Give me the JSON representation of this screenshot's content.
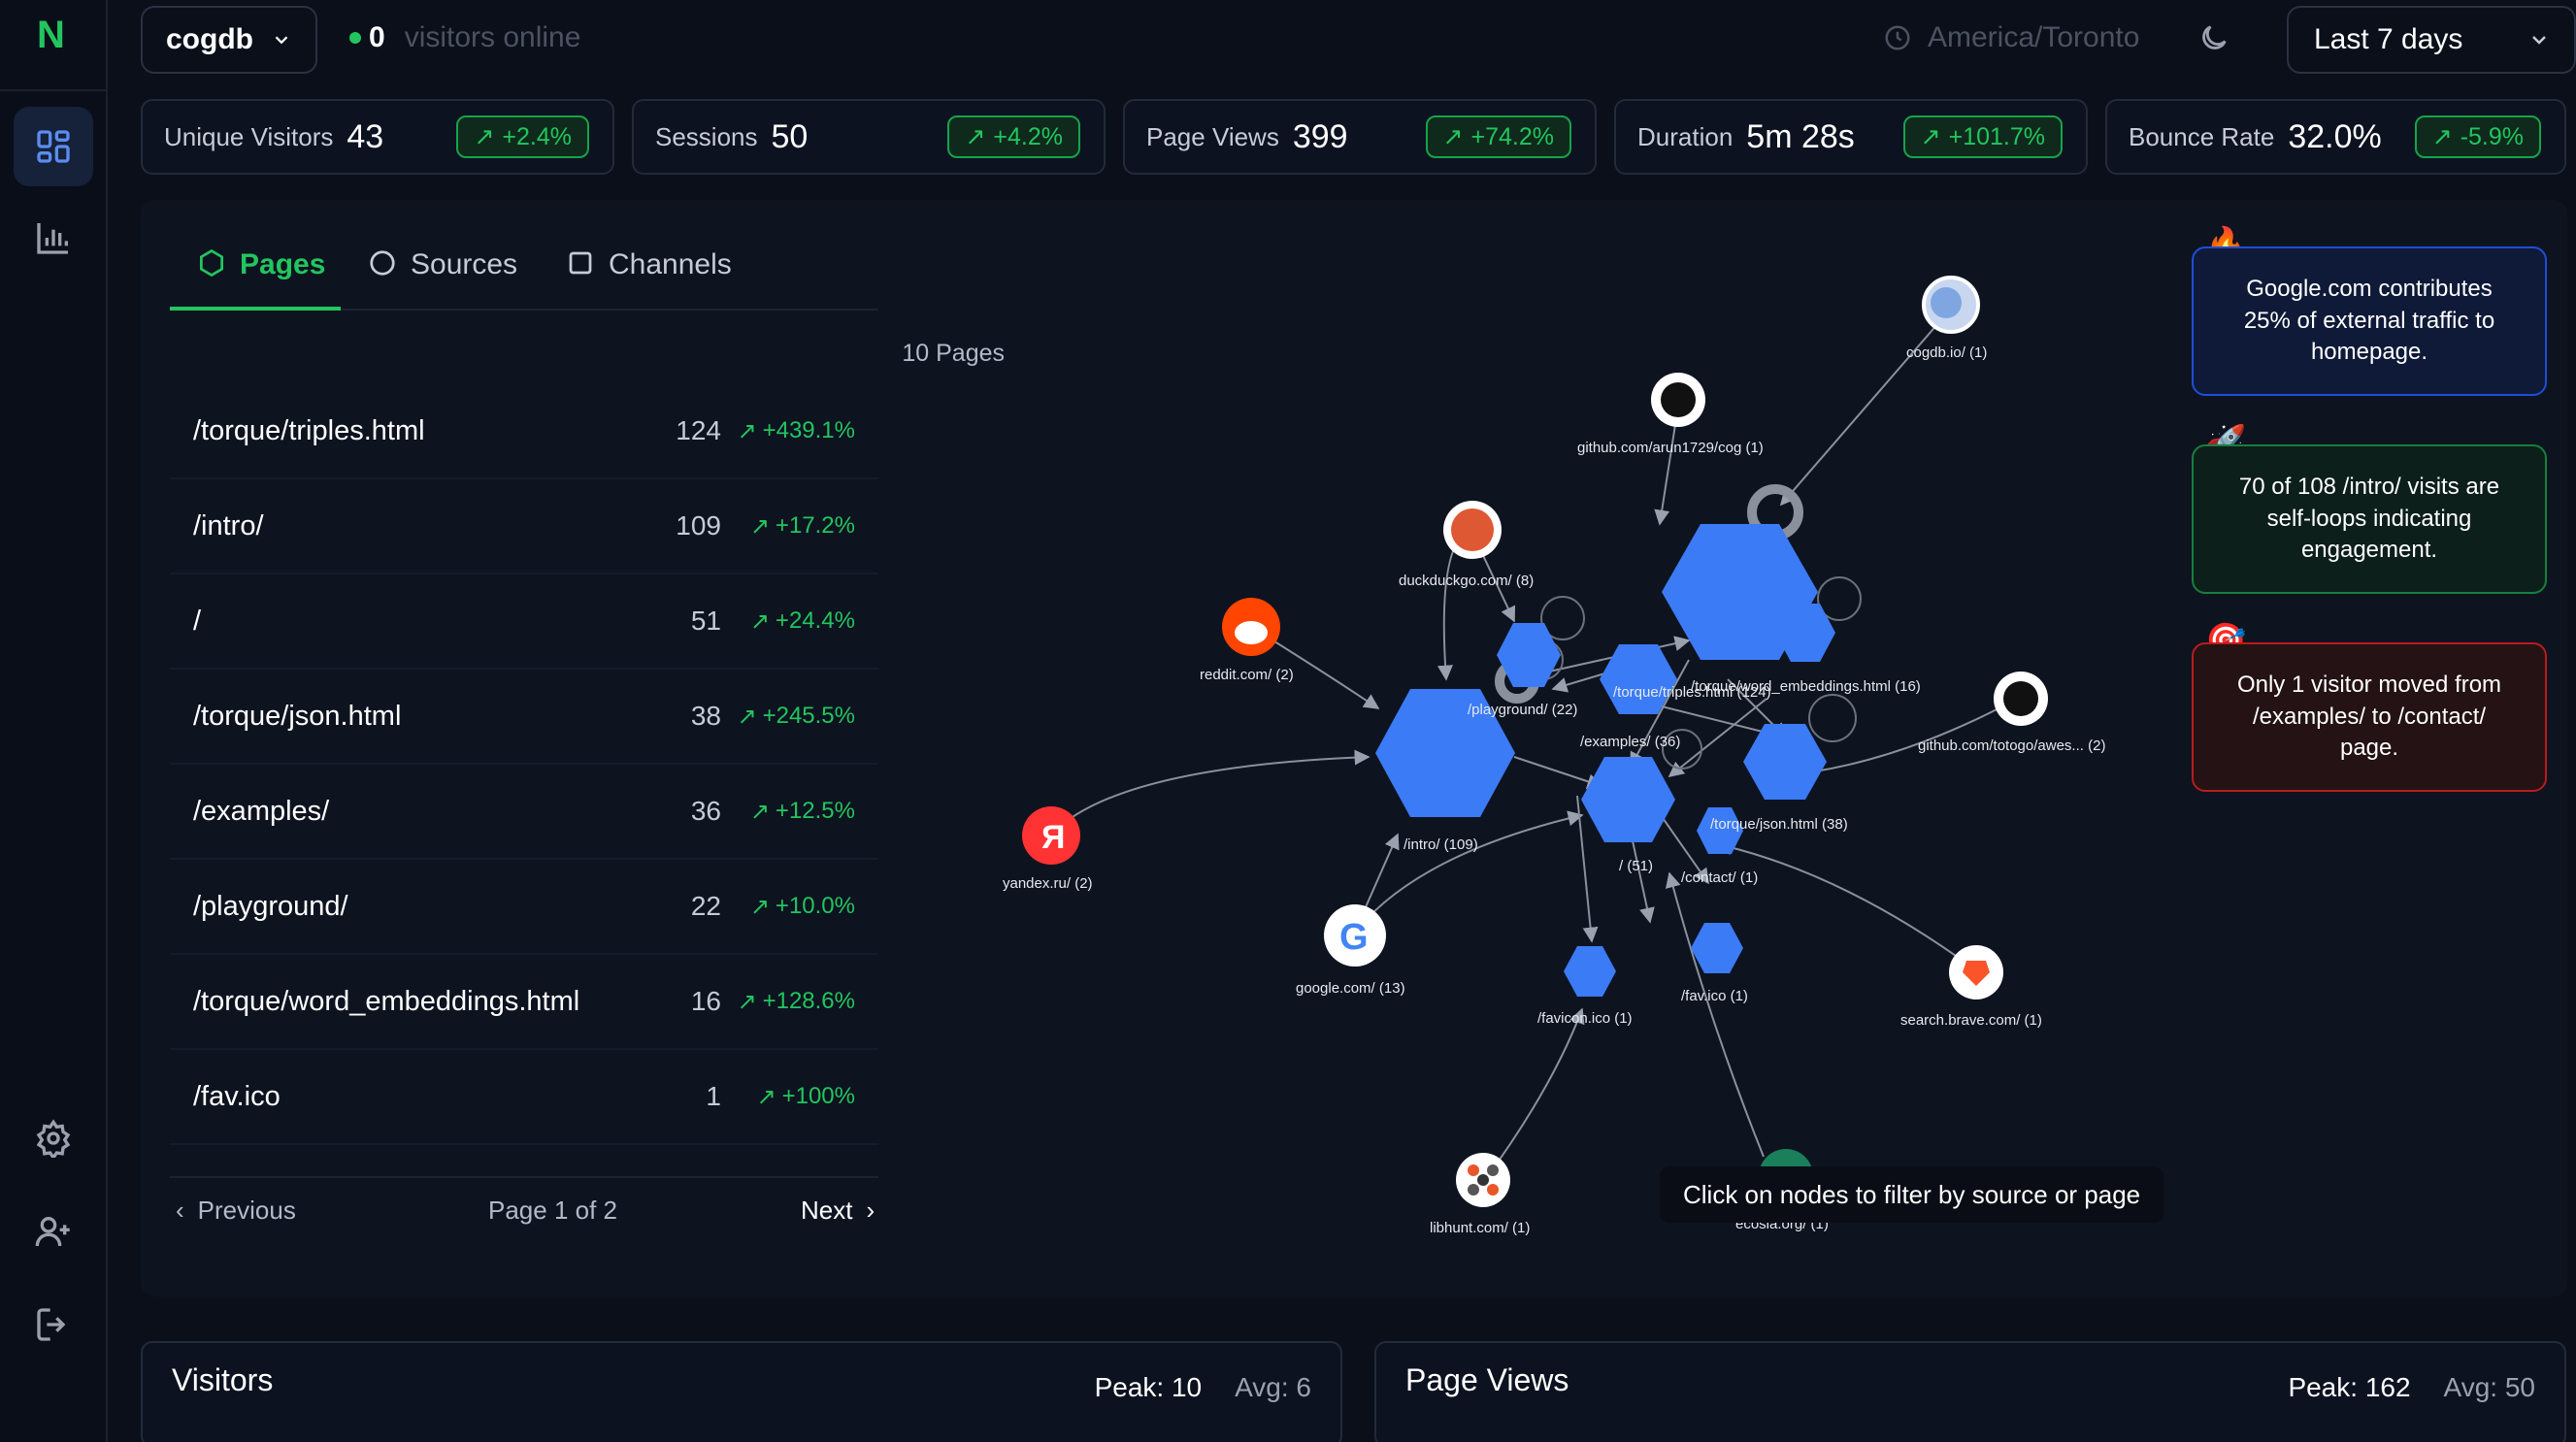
{
  "app": {
    "logo": "N",
    "site": "cogdb",
    "online_count": "0",
    "online_label": "visitors online",
    "timezone": "America/Toronto",
    "date_range": "Last 7 days"
  },
  "sidebar": {
    "items": [
      {
        "name": "dashboard",
        "icon": "dashboard-grid-icon",
        "active": true
      },
      {
        "name": "analytics",
        "icon": "bar-chart-icon"
      },
      {
        "name": "settings",
        "icon": "gear-icon"
      },
      {
        "name": "add-user",
        "icon": "add-user-icon"
      },
      {
        "name": "logout",
        "icon": "logout-icon"
      }
    ]
  },
  "stats": [
    {
      "label": "Unique Visitors",
      "value": "43",
      "change": "+2.4%"
    },
    {
      "label": "Sessions",
      "value": "50",
      "change": "+4.2%"
    },
    {
      "label": "Page Views",
      "value": "399",
      "change": "+74.2%"
    },
    {
      "label": "Duration",
      "value": "5m 28s",
      "change": "+101.7%"
    },
    {
      "label": "Bounce Rate",
      "value": "32.0%",
      "change": "-5.9%"
    }
  ],
  "tabs": [
    {
      "label": "Pages",
      "active": true,
      "icon": "hexagon-icon"
    },
    {
      "label": "Sources",
      "icon": "circle-icon"
    },
    {
      "label": "Channels",
      "icon": "square-icon"
    }
  ],
  "pages": {
    "count_label": "10 Pages",
    "rows": [
      {
        "path": "/torque/triples.html",
        "count": "124",
        "change": "+439.1%"
      },
      {
        "path": "/intro/",
        "count": "109",
        "change": "+17.2%"
      },
      {
        "path": "/",
        "count": "51",
        "change": "+24.4%"
      },
      {
        "path": "/torque/json.html",
        "count": "38",
        "change": "+245.5%"
      },
      {
        "path": "/examples/",
        "count": "36",
        "change": "+12.5%"
      },
      {
        "path": "/playground/",
        "count": "22",
        "change": "+10.0%"
      },
      {
        "path": "/torque/word_embeddings.html",
        "count": "16",
        "change": "+128.6%"
      },
      {
        "path": "/fav.ico",
        "count": "1",
        "change": "+100%"
      }
    ],
    "previous": "Previous",
    "page_label": "Page 1 of 2",
    "next": "Next"
  },
  "graph": {
    "hint": "Click on nodes to filter by source or page",
    "page_nodes": [
      "/torque/triples.html (124)",
      "/intro/ (109)",
      "/ (51)",
      "/torque/json.html (38)",
      "/examples/ (36)",
      "/playground/ (22)",
      "/torque/word_embeddings.html (16)",
      "/contact/ (1)",
      "/fav.ico (1)",
      "/favicon.ico (1)"
    ],
    "source_nodes": [
      {
        "label": "cogdb.io/ (1)",
        "icon": "globe-icon"
      },
      {
        "label": "github.com/arun1729/cog (1)",
        "icon": "github-icon"
      },
      {
        "label": "duckduckgo.com/ (8)",
        "icon": "duckduckgo-icon"
      },
      {
        "label": "reddit.com/ (2)",
        "icon": "reddit-icon"
      },
      {
        "label": "github.com/totogo/awes... (2)",
        "icon": "github-icon"
      },
      {
        "label": "yandex.ru/ (2)",
        "icon": "yandex-icon"
      },
      {
        "label": "google.com/ (13)",
        "icon": "google-icon"
      },
      {
        "label": "search.brave.com/ (1)",
        "icon": "brave-icon"
      },
      {
        "label": "libhunt.com/ (1)",
        "icon": "libhunt-icon"
      },
      {
        "label": "ecosia.org/ (1)",
        "icon": "ecosia-icon"
      }
    ]
  },
  "insights": [
    {
      "icon": "fire-icon",
      "text": "Google.com contributes 25% of external traffic to homepage.",
      "color": "#1d4ed8"
    },
    {
      "icon": "rocket-icon",
      "text": "70 of 108 /intro/ visits are self-loops indicating engagement.",
      "color": "#15803d"
    },
    {
      "icon": "target-icon",
      "text": "Only 1 visitor moved from /examples/ to /contact/ page.",
      "color": "#b91c1c"
    }
  ],
  "bottom": {
    "visitors": {
      "title": "Visitors",
      "peak": "Peak: 10",
      "avg": "Avg: 6"
    },
    "pageviews": {
      "title": "Page Views",
      "peak": "Peak: 162",
      "avg": "Avg: 50"
    }
  },
  "colors": {
    "accent": "#22c55e",
    "node": "#3b7bf6",
    "background": "#0b0f1a"
  }
}
